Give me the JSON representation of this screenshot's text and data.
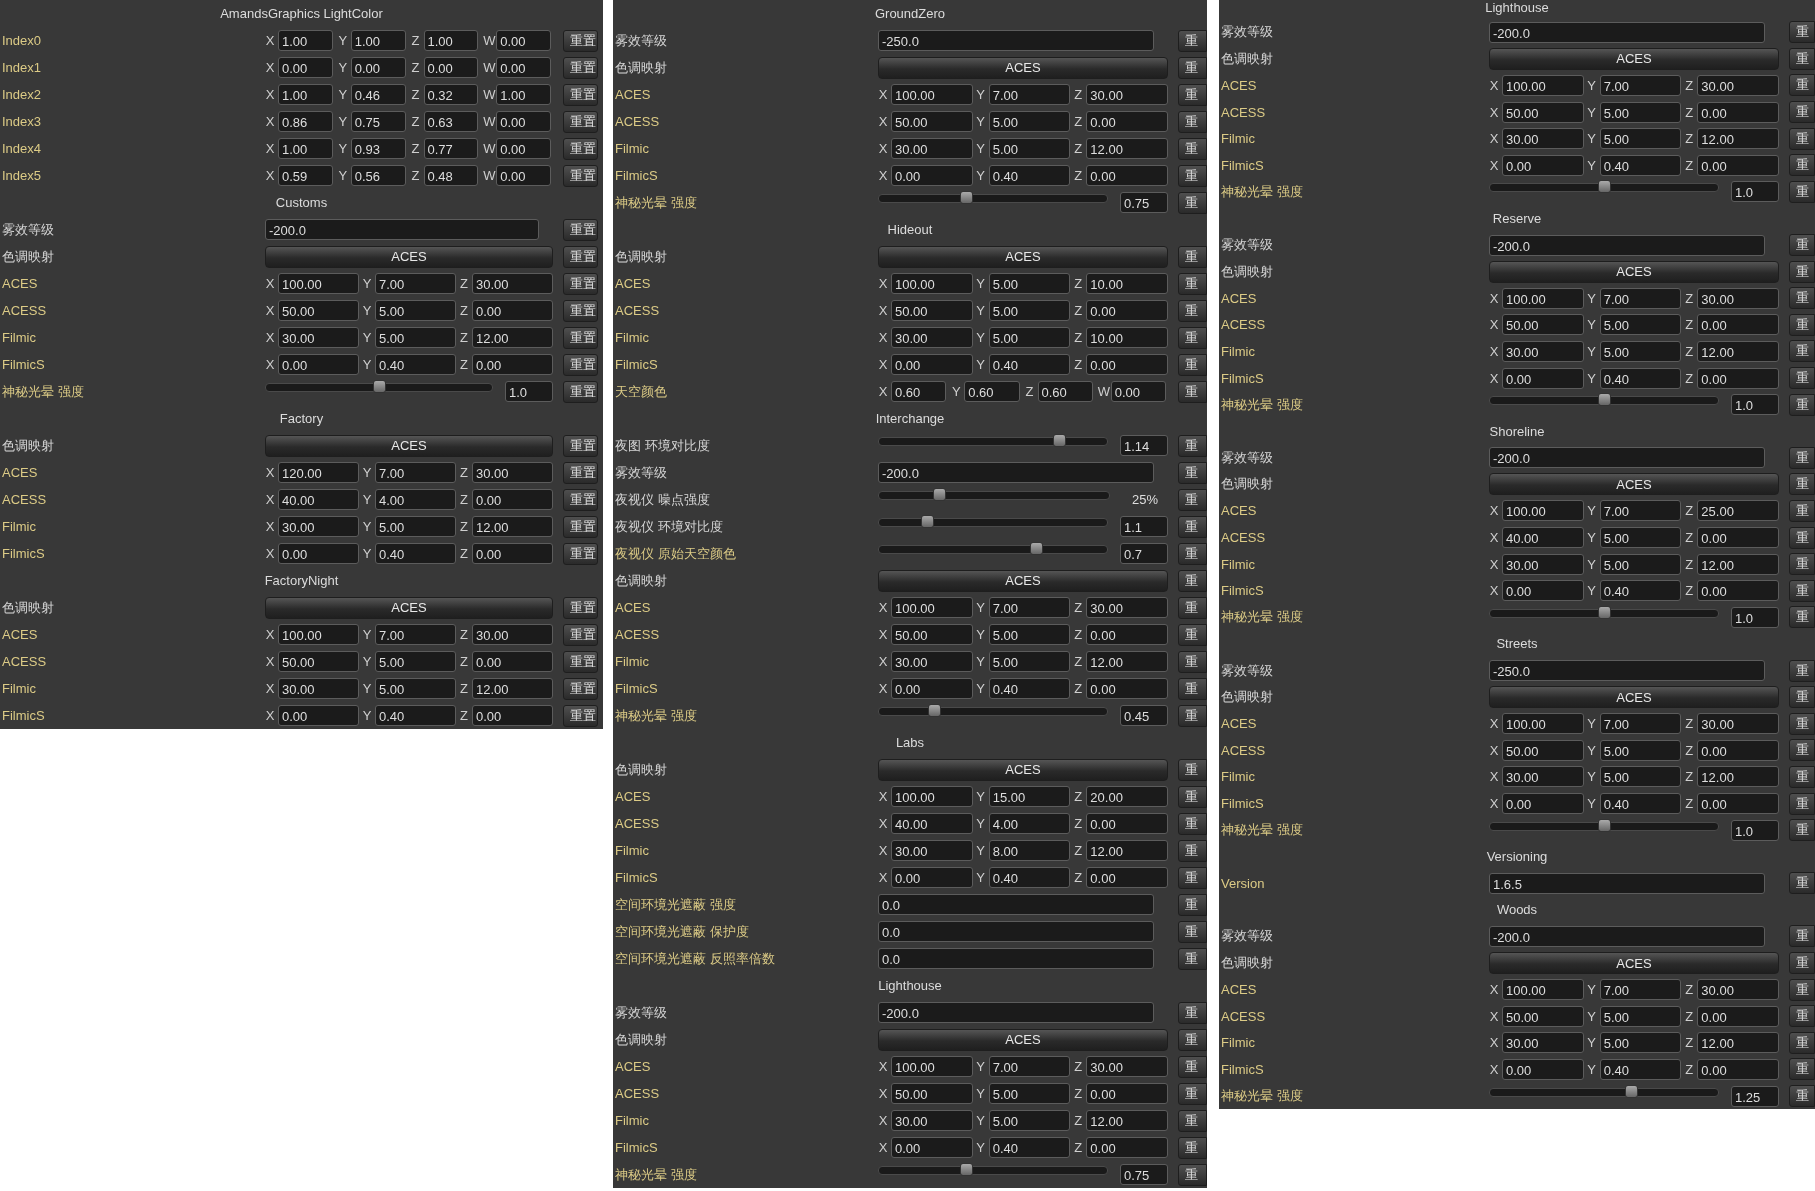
{
  "panels": [
    {
      "sections": [
        {
          "title": "AmandsGraphics LightColor",
          "rows": [
            {
              "kind": "vector",
              "label": "Index0",
              "overridden": true,
              "axes": [
                "X",
                "Y",
                "Z",
                "W"
              ],
              "values": [
                "1.00",
                "1.00",
                "1.00",
                "0.00"
              ],
              "reset": "重置"
            },
            {
              "kind": "vector",
              "label": "Index1",
              "overridden": true,
              "axes": [
                "X",
                "Y",
                "Z",
                "W"
              ],
              "values": [
                "0.00",
                "0.00",
                "0.00",
                "0.00"
              ],
              "reset": "重置"
            },
            {
              "kind": "vector",
              "label": "Index2",
              "overridden": true,
              "axes": [
                "X",
                "Y",
                "Z",
                "W"
              ],
              "values": [
                "1.00",
                "0.46",
                "0.32",
                "1.00"
              ],
              "reset": "重置"
            },
            {
              "kind": "vector",
              "label": "Index3",
              "overridden": true,
              "axes": [
                "X",
                "Y",
                "Z",
                "W"
              ],
              "values": [
                "0.86",
                "0.75",
                "0.63",
                "0.00"
              ],
              "reset": "重置"
            },
            {
              "kind": "vector",
              "label": "Index4",
              "overridden": true,
              "axes": [
                "X",
                "Y",
                "Z",
                "W"
              ],
              "values": [
                "1.00",
                "0.93",
                "0.77",
                "0.00"
              ],
              "reset": "重置"
            },
            {
              "kind": "vector",
              "label": "Index5",
              "overridden": true,
              "axes": [
                "X",
                "Y",
                "Z",
                "W"
              ],
              "values": [
                "0.59",
                "0.56",
                "0.48",
                "0.00"
              ],
              "reset": "重置"
            }
          ]
        },
        {
          "title": "Customs",
          "rows": [
            {
              "kind": "text",
              "label": "雾效等级",
              "overridden": false,
              "value": "-200.0",
              "reset": "重置"
            },
            {
              "kind": "dropdown",
              "label": "色调映射",
              "overridden": false,
              "value": "ACES",
              "reset": "重置"
            },
            {
              "kind": "vector",
              "label": "ACES",
              "overridden": true,
              "axes": [
                "X",
                "Y",
                "Z"
              ],
              "values": [
                "100.00",
                "7.00",
                "30.00"
              ],
              "reset": "重置"
            },
            {
              "kind": "vector",
              "label": "ACESS",
              "overridden": true,
              "axes": [
                "X",
                "Y",
                "Z"
              ],
              "values": [
                "50.00",
                "5.00",
                "0.00"
              ],
              "reset": "重置"
            },
            {
              "kind": "vector",
              "label": "Filmic",
              "overridden": true,
              "axes": [
                "X",
                "Y",
                "Z"
              ],
              "values": [
                "30.00",
                "5.00",
                "12.00"
              ],
              "reset": "重置"
            },
            {
              "kind": "vector",
              "label": "FilmicS",
              "overridden": true,
              "axes": [
                "X",
                "Y",
                "Z"
              ],
              "values": [
                "0.00",
                "0.40",
                "0.00"
              ],
              "reset": "重置"
            },
            {
              "kind": "slider",
              "label": "神秘光晕 强度",
              "overridden": true,
              "level": 0.5,
              "value": "1.0",
              "reset": "重置"
            }
          ]
        },
        {
          "title": "Factory",
          "rows": [
            {
              "kind": "dropdown",
              "label": "色调映射",
              "overridden": false,
              "value": "ACES",
              "reset": "重置"
            },
            {
              "kind": "vector",
              "label": "ACES",
              "overridden": true,
              "axes": [
                "X",
                "Y",
                "Z"
              ],
              "values": [
                "120.00",
                "7.00",
                "30.00"
              ],
              "reset": "重置"
            },
            {
              "kind": "vector",
              "label": "ACESS",
              "overridden": true,
              "axes": [
                "X",
                "Y",
                "Z"
              ],
              "values": [
                "40.00",
                "4.00",
                "0.00"
              ],
              "reset": "重置"
            },
            {
              "kind": "vector",
              "label": "Filmic",
              "overridden": true,
              "axes": [
                "X",
                "Y",
                "Z"
              ],
              "values": [
                "30.00",
                "5.00",
                "12.00"
              ],
              "reset": "重置"
            },
            {
              "kind": "vector",
              "label": "FilmicS",
              "overridden": true,
              "axes": [
                "X",
                "Y",
                "Z"
              ],
              "values": [
                "0.00",
                "0.40",
                "0.00"
              ],
              "reset": "重置"
            }
          ]
        },
        {
          "title": "FactoryNight",
          "rows": [
            {
              "kind": "dropdown",
              "label": "色调映射",
              "overridden": false,
              "value": "ACES",
              "reset": "重置"
            },
            {
              "kind": "vector",
              "label": "ACES",
              "overridden": true,
              "axes": [
                "X",
                "Y",
                "Z"
              ],
              "values": [
                "100.00",
                "7.00",
                "30.00"
              ],
              "reset": "重置"
            },
            {
              "kind": "vector",
              "label": "ACESS",
              "overridden": true,
              "axes": [
                "X",
                "Y",
                "Z"
              ],
              "values": [
                "50.00",
                "5.00",
                "0.00"
              ],
              "reset": "重置"
            },
            {
              "kind": "vector",
              "label": "Filmic",
              "overridden": true,
              "axes": [
                "X",
                "Y",
                "Z"
              ],
              "values": [
                "30.00",
                "5.00",
                "12.00"
              ],
              "reset": "重置"
            },
            {
              "kind": "vector",
              "label": "FilmicS",
              "overridden": true,
              "axes": [
                "X",
                "Y",
                "Z"
              ],
              "values": [
                "0.00",
                "0.40",
                "0.00"
              ],
              "reset": "重置"
            }
          ]
        }
      ]
    },
    {
      "sections": [
        {
          "title": "GroundZero",
          "rows": [
            {
              "kind": "text",
              "label": "雾效等级",
              "overridden": false,
              "value": "-250.0",
              "reset": "重"
            },
            {
              "kind": "dropdown",
              "label": "色调映射",
              "overridden": false,
              "value": "ACES",
              "reset": "重"
            },
            {
              "kind": "vector",
              "label": "ACES",
              "overridden": true,
              "axes": [
                "X",
                "Y",
                "Z"
              ],
              "values": [
                "100.00",
                "7.00",
                "30.00"
              ],
              "reset": "重"
            },
            {
              "kind": "vector",
              "label": "ACESS",
              "overridden": true,
              "axes": [
                "X",
                "Y",
                "Z"
              ],
              "values": [
                "50.00",
                "5.00",
                "0.00"
              ],
              "reset": "重"
            },
            {
              "kind": "vector",
              "label": "Filmic",
              "overridden": true,
              "axes": [
                "X",
                "Y",
                "Z"
              ],
              "values": [
                "30.00",
                "5.00",
                "12.00"
              ],
              "reset": "重"
            },
            {
              "kind": "vector",
              "label": "FilmicS",
              "overridden": true,
              "axes": [
                "X",
                "Y",
                "Z"
              ],
              "values": [
                "0.00",
                "0.40",
                "0.00"
              ],
              "reset": "重"
            },
            {
              "kind": "slider",
              "label": "神秘光晕 强度",
              "overridden": true,
              "level": 0.38,
              "value": "0.75",
              "reset": "重"
            }
          ]
        },
        {
          "title": "Hideout",
          "rows": [
            {
              "kind": "dropdown",
              "label": "色调映射",
              "overridden": false,
              "value": "ACES",
              "reset": "重"
            },
            {
              "kind": "vector",
              "label": "ACES",
              "overridden": true,
              "axes": [
                "X",
                "Y",
                "Z"
              ],
              "values": [
                "100.00",
                "5.00",
                "10.00"
              ],
              "reset": "重"
            },
            {
              "kind": "vector",
              "label": "ACESS",
              "overridden": true,
              "axes": [
                "X",
                "Y",
                "Z"
              ],
              "values": [
                "50.00",
                "5.00",
                "0.00"
              ],
              "reset": "重"
            },
            {
              "kind": "vector",
              "label": "Filmic",
              "overridden": true,
              "axes": [
                "X",
                "Y",
                "Z"
              ],
              "values": [
                "30.00",
                "5.00",
                "10.00"
              ],
              "reset": "重"
            },
            {
              "kind": "vector",
              "label": "FilmicS",
              "overridden": true,
              "axes": [
                "X",
                "Y",
                "Z"
              ],
              "values": [
                "0.00",
                "0.40",
                "0.00"
              ],
              "reset": "重"
            },
            {
              "kind": "vector",
              "label": "天空颜色",
              "overridden": true,
              "axes": [
                "X",
                "Y",
                "Z",
                "W"
              ],
              "values": [
                "0.60",
                "0.60",
                "0.60",
                "0.00"
              ],
              "reset": "重"
            }
          ]
        },
        {
          "title": "Interchange",
          "rows": [
            {
              "kind": "slider",
              "label": "夜图 环境对比度",
              "overridden": false,
              "level": 0.79,
              "value": "1.14",
              "reset": "重"
            },
            {
              "kind": "text",
              "label": "雾效等级",
              "overridden": false,
              "value": "-200.0",
              "reset": "重"
            },
            {
              "kind": "slider_readout",
              "label": "夜视仪 噪点强度",
              "overridden": false,
              "level": 0.26,
              "value": "25%",
              "reset": "重"
            },
            {
              "kind": "slider",
              "label": "夜视仪 环境对比度",
              "overridden": false,
              "level": 0.21,
              "value": "1.1",
              "reset": "重"
            },
            {
              "kind": "slider",
              "label": "夜视仪 原始天空颜色",
              "overridden": true,
              "level": 0.69,
              "value": "0.7",
              "reset": "重"
            },
            {
              "kind": "dropdown",
              "label": "色调映射",
              "overridden": false,
              "value": "ACES",
              "reset": "重"
            },
            {
              "kind": "vector",
              "label": "ACES",
              "overridden": true,
              "axes": [
                "X",
                "Y",
                "Z"
              ],
              "values": [
                "100.00",
                "7.00",
                "30.00"
              ],
              "reset": "重"
            },
            {
              "kind": "vector",
              "label": "ACESS",
              "overridden": true,
              "axes": [
                "X",
                "Y",
                "Z"
              ],
              "values": [
                "50.00",
                "5.00",
                "0.00"
              ],
              "reset": "重"
            },
            {
              "kind": "vector",
              "label": "Filmic",
              "overridden": true,
              "axes": [
                "X",
                "Y",
                "Z"
              ],
              "values": [
                "30.00",
                "5.00",
                "12.00"
              ],
              "reset": "重"
            },
            {
              "kind": "vector",
              "label": "FilmicS",
              "overridden": true,
              "axes": [
                "X",
                "Y",
                "Z"
              ],
              "values": [
                "0.00",
                "0.40",
                "0.00"
              ],
              "reset": "重"
            },
            {
              "kind": "slider",
              "label": "神秘光晕 强度",
              "overridden": true,
              "level": 0.24,
              "value": "0.45",
              "reset": "重"
            }
          ]
        },
        {
          "title": "Labs",
          "rows": [
            {
              "kind": "dropdown",
              "label": "色调映射",
              "overridden": false,
              "value": "ACES",
              "reset": "重"
            },
            {
              "kind": "vector",
              "label": "ACES",
              "overridden": true,
              "axes": [
                "X",
                "Y",
                "Z"
              ],
              "values": [
                "100.00",
                "15.00",
                "20.00"
              ],
              "reset": "重"
            },
            {
              "kind": "vector",
              "label": "ACESS",
              "overridden": true,
              "axes": [
                "X",
                "Y",
                "Z"
              ],
              "values": [
                "40.00",
                "4.00",
                "0.00"
              ],
              "reset": "重"
            },
            {
              "kind": "vector",
              "label": "Filmic",
              "overridden": true,
              "axes": [
                "X",
                "Y",
                "Z"
              ],
              "values": [
                "30.00",
                "8.00",
                "12.00"
              ],
              "reset": "重"
            },
            {
              "kind": "vector",
              "label": "FilmicS",
              "overridden": true,
              "axes": [
                "X",
                "Y",
                "Z"
              ],
              "values": [
                "0.00",
                "0.40",
                "0.00"
              ],
              "reset": "重"
            },
            {
              "kind": "text",
              "label": "空间环境光遮蔽 强度",
              "overridden": true,
              "value": "0.0",
              "reset": "重"
            },
            {
              "kind": "text",
              "label": "空间环境光遮蔽 保护度",
              "overridden": true,
              "value": "0.0",
              "reset": "重"
            },
            {
              "kind": "text",
              "label": "空间环境光遮蔽 反照率倍数",
              "overridden": true,
              "value": "0.0",
              "reset": "重"
            }
          ]
        },
        {
          "title": "Lighthouse",
          "rows": [
            {
              "kind": "text",
              "label": "雾效等级",
              "overridden": false,
              "value": "-200.0",
              "reset": "重"
            },
            {
              "kind": "dropdown",
              "label": "色调映射",
              "overridden": false,
              "value": "ACES",
              "reset": "重"
            },
            {
              "kind": "vector",
              "label": "ACES",
              "overridden": true,
              "axes": [
                "X",
                "Y",
                "Z"
              ],
              "values": [
                "100.00",
                "7.00",
                "30.00"
              ],
              "reset": "重"
            },
            {
              "kind": "vector",
              "label": "ACESS",
              "overridden": true,
              "axes": [
                "X",
                "Y",
                "Z"
              ],
              "values": [
                "50.00",
                "5.00",
                "0.00"
              ],
              "reset": "重"
            },
            {
              "kind": "vector",
              "label": "Filmic",
              "overridden": true,
              "axes": [
                "X",
                "Y",
                "Z"
              ],
              "values": [
                "30.00",
                "5.00",
                "12.00"
              ],
              "reset": "重"
            },
            {
              "kind": "vector",
              "label": "FilmicS",
              "overridden": true,
              "axes": [
                "X",
                "Y",
                "Z"
              ],
              "values": [
                "0.00",
                "0.40",
                "0.00"
              ],
              "reset": "重"
            },
            {
              "kind": "slider",
              "label": "神秘光晕 强度",
              "overridden": true,
              "level": 0.38,
              "value": "0.75",
              "reset": "重"
            }
          ]
        }
      ]
    },
    {
      "sections": [
        {
          "title": "Lighthouse",
          "rows": [
            {
              "kind": "text",
              "label": "雾效等级",
              "overridden": false,
              "value": "-200.0",
              "reset": "重"
            },
            {
              "kind": "dropdown",
              "label": "色调映射",
              "overridden": false,
              "value": "ACES",
              "reset": "重"
            },
            {
              "kind": "vector",
              "label": "ACES",
              "overridden": true,
              "axes": [
                "X",
                "Y",
                "Z"
              ],
              "values": [
                "100.00",
                "7.00",
                "30.00"
              ],
              "reset": "重"
            },
            {
              "kind": "vector",
              "label": "ACESS",
              "overridden": true,
              "axes": [
                "X",
                "Y",
                "Z"
              ],
              "values": [
                "50.00",
                "5.00",
                "0.00"
              ],
              "reset": "重"
            },
            {
              "kind": "vector",
              "label": "Filmic",
              "overridden": true,
              "axes": [
                "X",
                "Y",
                "Z"
              ],
              "values": [
                "30.00",
                "5.00",
                "12.00"
              ],
              "reset": "重"
            },
            {
              "kind": "vector",
              "label": "FilmicS",
              "overridden": true,
              "axes": [
                "X",
                "Y",
                "Z"
              ],
              "values": [
                "0.00",
                "0.40",
                "0.00"
              ],
              "reset": "重"
            },
            {
              "kind": "slider",
              "label": "神秘光晕 强度",
              "overridden": true,
              "level": 0.5,
              "value": "1.0",
              "reset": "重"
            }
          ]
        },
        {
          "title": "Reserve",
          "rows": [
            {
              "kind": "text",
              "label": "雾效等级",
              "overridden": false,
              "value": "-200.0",
              "reset": "重"
            },
            {
              "kind": "dropdown",
              "label": "色调映射",
              "overridden": false,
              "value": "ACES",
              "reset": "重"
            },
            {
              "kind": "vector",
              "label": "ACES",
              "overridden": true,
              "axes": [
                "X",
                "Y",
                "Z"
              ],
              "values": [
                "100.00",
                "7.00",
                "30.00"
              ],
              "reset": "重"
            },
            {
              "kind": "vector",
              "label": "ACESS",
              "overridden": true,
              "axes": [
                "X",
                "Y",
                "Z"
              ],
              "values": [
                "50.00",
                "5.00",
                "0.00"
              ],
              "reset": "重"
            },
            {
              "kind": "vector",
              "label": "Filmic",
              "overridden": true,
              "axes": [
                "X",
                "Y",
                "Z"
              ],
              "values": [
                "30.00",
                "5.00",
                "12.00"
              ],
              "reset": "重"
            },
            {
              "kind": "vector",
              "label": "FilmicS",
              "overridden": true,
              "axes": [
                "X",
                "Y",
                "Z"
              ],
              "values": [
                "0.00",
                "0.40",
                "0.00"
              ],
              "reset": "重"
            },
            {
              "kind": "slider",
              "label": "神秘光晕 强度",
              "overridden": true,
              "level": 0.5,
              "value": "1.0",
              "reset": "重"
            }
          ]
        },
        {
          "title": "Shoreline",
          "rows": [
            {
              "kind": "text",
              "label": "雾效等级",
              "overridden": false,
              "value": "-200.0",
              "reset": "重"
            },
            {
              "kind": "dropdown",
              "label": "色调映射",
              "overridden": false,
              "value": "ACES",
              "reset": "重"
            },
            {
              "kind": "vector",
              "label": "ACES",
              "overridden": true,
              "axes": [
                "X",
                "Y",
                "Z"
              ],
              "values": [
                "100.00",
                "7.00",
                "25.00"
              ],
              "reset": "重"
            },
            {
              "kind": "vector",
              "label": "ACESS",
              "overridden": true,
              "axes": [
                "X",
                "Y",
                "Z"
              ],
              "values": [
                "40.00",
                "5.00",
                "0.00"
              ],
              "reset": "重"
            },
            {
              "kind": "vector",
              "label": "Filmic",
              "overridden": true,
              "axes": [
                "X",
                "Y",
                "Z"
              ],
              "values": [
                "30.00",
                "5.00",
                "12.00"
              ],
              "reset": "重"
            },
            {
              "kind": "vector",
              "label": "FilmicS",
              "overridden": true,
              "axes": [
                "X",
                "Y",
                "Z"
              ],
              "values": [
                "0.00",
                "0.40",
                "0.00"
              ],
              "reset": "重"
            },
            {
              "kind": "slider",
              "label": "神秘光晕 强度",
              "overridden": true,
              "level": 0.5,
              "value": "1.0",
              "reset": "重"
            }
          ]
        },
        {
          "title": "Streets",
          "rows": [
            {
              "kind": "text",
              "label": "雾效等级",
              "overridden": false,
              "value": "-250.0",
              "reset": "重"
            },
            {
              "kind": "dropdown",
              "label": "色调映射",
              "overridden": false,
              "value": "ACES",
              "reset": "重"
            },
            {
              "kind": "vector",
              "label": "ACES",
              "overridden": true,
              "axes": [
                "X",
                "Y",
                "Z"
              ],
              "values": [
                "100.00",
                "7.00",
                "30.00"
              ],
              "reset": "重"
            },
            {
              "kind": "vector",
              "label": "ACESS",
              "overridden": true,
              "axes": [
                "X",
                "Y",
                "Z"
              ],
              "values": [
                "50.00",
                "5.00",
                "0.00"
              ],
              "reset": "重"
            },
            {
              "kind": "vector",
              "label": "Filmic",
              "overridden": true,
              "axes": [
                "X",
                "Y",
                "Z"
              ],
              "values": [
                "30.00",
                "5.00",
                "12.00"
              ],
              "reset": "重"
            },
            {
              "kind": "vector",
              "label": "FilmicS",
              "overridden": true,
              "axes": [
                "X",
                "Y",
                "Z"
              ],
              "values": [
                "0.00",
                "0.40",
                "0.00"
              ],
              "reset": "重"
            },
            {
              "kind": "slider",
              "label": "神秘光晕 强度",
              "overridden": true,
              "level": 0.5,
              "value": "1.0",
              "reset": "重"
            }
          ]
        },
        {
          "title": "Versioning",
          "rows": [
            {
              "kind": "text",
              "label": "Version",
              "overridden": true,
              "value": "1.6.5",
              "reset": "重"
            }
          ]
        },
        {
          "title": "Woods",
          "rows": [
            {
              "kind": "text",
              "label": "雾效等级",
              "overridden": false,
              "value": "-200.0",
              "reset": "重"
            },
            {
              "kind": "dropdown",
              "label": "色调映射",
              "overridden": false,
              "value": "ACES",
              "reset": "重"
            },
            {
              "kind": "vector",
              "label": "ACES",
              "overridden": true,
              "axes": [
                "X",
                "Y",
                "Z"
              ],
              "values": [
                "100.00",
                "7.00",
                "30.00"
              ],
              "reset": "重"
            },
            {
              "kind": "vector",
              "label": "ACESS",
              "overridden": true,
              "axes": [
                "X",
                "Y",
                "Z"
              ],
              "values": [
                "50.00",
                "5.00",
                "0.00"
              ],
              "reset": "重"
            },
            {
              "kind": "vector",
              "label": "Filmic",
              "overridden": true,
              "axes": [
                "X",
                "Y",
                "Z"
              ],
              "values": [
                "30.00",
                "5.00",
                "12.00"
              ],
              "reset": "重"
            },
            {
              "kind": "vector",
              "label": "FilmicS",
              "overridden": true,
              "axes": [
                "X",
                "Y",
                "Z"
              ],
              "values": [
                "0.00",
                "0.40",
                "0.00"
              ],
              "reset": "重"
            },
            {
              "kind": "slider",
              "label": "神秘光晕 强度",
              "overridden": true,
              "level": 0.62,
              "value": "1.25",
              "reset": "重"
            }
          ]
        }
      ]
    }
  ]
}
